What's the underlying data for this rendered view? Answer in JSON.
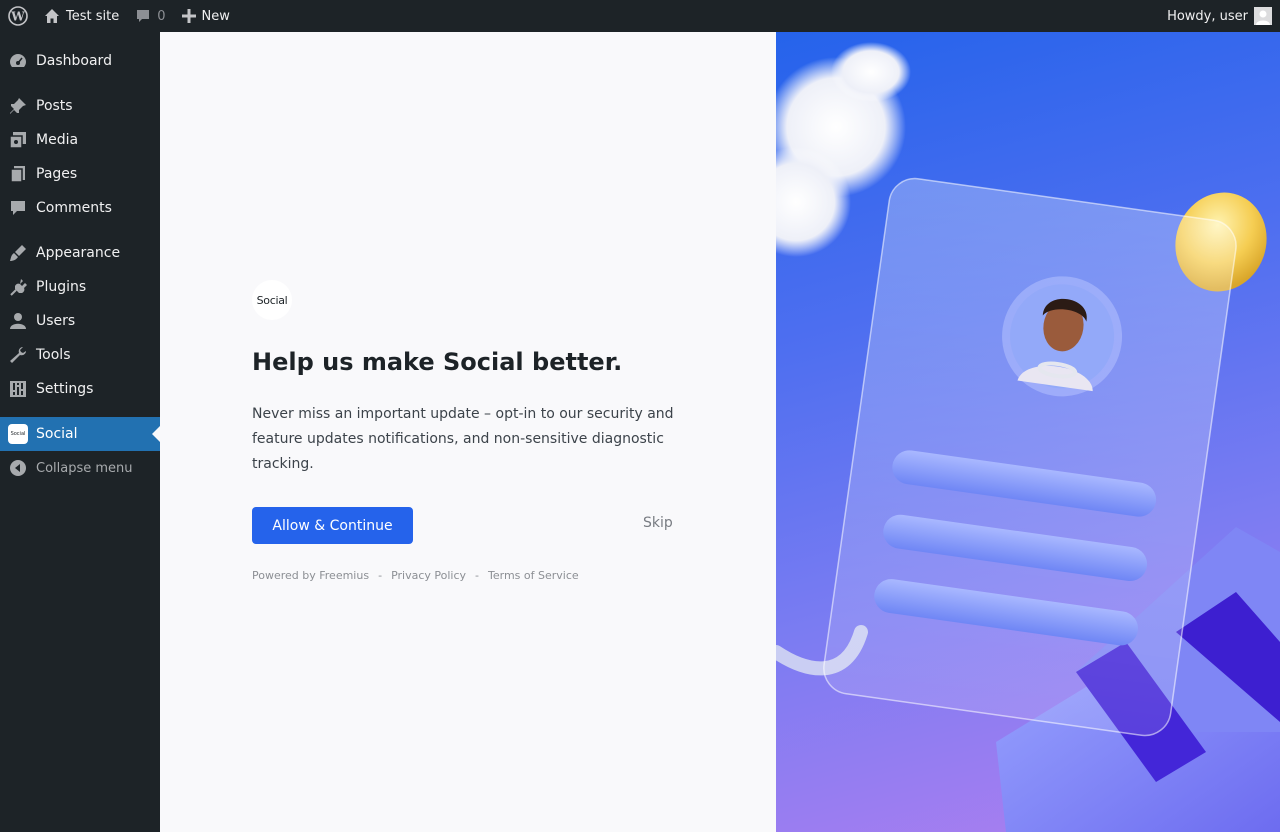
{
  "adminbar": {
    "site_name": "Test site",
    "comment_count": "0",
    "new_label": "New",
    "greeting": "Howdy, user"
  },
  "sidebar": {
    "items": [
      {
        "label": "Dashboard",
        "icon": "dashboard-icon"
      },
      {
        "label": "Posts",
        "icon": "pin-icon"
      },
      {
        "label": "Media",
        "icon": "media-icon"
      },
      {
        "label": "Pages",
        "icon": "pages-icon"
      },
      {
        "label": "Comments",
        "icon": "comment-icon"
      },
      {
        "label": "Appearance",
        "icon": "brush-icon"
      },
      {
        "label": "Plugins",
        "icon": "plug-icon"
      },
      {
        "label": "Users",
        "icon": "user-icon"
      },
      {
        "label": "Tools",
        "icon": "wrench-icon"
      },
      {
        "label": "Settings",
        "icon": "settings-icon"
      },
      {
        "label": "Social",
        "icon": "social-logo-icon",
        "active": true
      }
    ],
    "collapse_label": "Collapse menu",
    "social_badge_text": "Social"
  },
  "optin": {
    "logo_text": "Social",
    "heading": "Help us make Social better.",
    "description": "Never miss an important update – opt-in to our security and feature updates notifications, and non-sensitive diagnostic tracking.",
    "allow_label": "Allow & Continue",
    "skip_label": "Skip",
    "footer": {
      "powered_by": "Powered by Freemius",
      "separator": "-",
      "privacy": "Privacy Policy",
      "terms": "Terms of Service"
    }
  },
  "colors": {
    "adminbar_bg": "#1d2327",
    "menu_active": "#2271b1",
    "primary_button": "#2563eb",
    "hero_start": "#2563eb",
    "hero_end": "#b07ef0"
  }
}
